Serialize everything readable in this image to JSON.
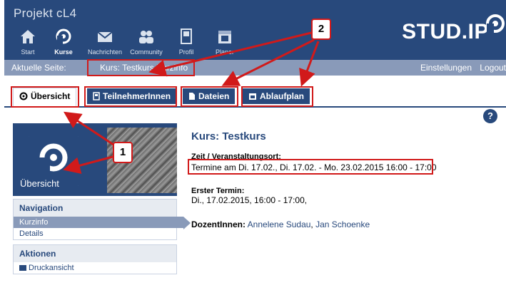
{
  "header": {
    "project_title": "Projekt cL4",
    "logo_text": "STUD.IP",
    "nav": [
      {
        "label": "Start",
        "icon": "home-icon"
      },
      {
        "label": "Kurse",
        "icon": "courses-icon"
      },
      {
        "label": "Nachrichten",
        "icon": "messages-icon"
      },
      {
        "label": "Community",
        "icon": "community-icon"
      },
      {
        "label": "Profil",
        "icon": "profile-icon"
      },
      {
        "label": "Planer",
        "icon": "planner-icon"
      }
    ]
  },
  "crumbbar": {
    "label": "Aktuelle Seite:",
    "path": "Kurs: Testkurs   Kurzinfo",
    "settings": "Einstellungen",
    "logout": "Logout"
  },
  "tabs": [
    {
      "label": "Übersicht"
    },
    {
      "label": "TeilnehmerInnen"
    },
    {
      "label": "Dateien"
    },
    {
      "label": "Ablaufplan"
    }
  ],
  "help": "?",
  "sidebar": {
    "title": "Übersicht",
    "nav_head": "Navigation",
    "nav_items": [
      "Kurzinfo",
      "Details"
    ],
    "actions_head": "Aktionen",
    "action_items": [
      "Druckansicht"
    ]
  },
  "main": {
    "title": "Kurs: Testkurs",
    "zeit_label": "Zeit / Veranstaltungsort:",
    "zeit_value": "Termine am Di. 17.02., Di. 17.02. - Mo. 23.02.2015 16:00 - 17:00",
    "first_label": "Erster Termin:",
    "first_value": "Di., 17.02.2015, 16:00 - 17:00,",
    "dozent_label": "DozentInnen:",
    "dozent_1": "Annelene Sudau",
    "dozent_sep": ", ",
    "dozent_2": "Jan Schoenke"
  },
  "annotations": {
    "callout_1": "1",
    "callout_2": "2",
    "color": "#d11a1a"
  },
  "colors": {
    "header_bg": "#28497c",
    "crumb_bg": "#899ab9"
  }
}
